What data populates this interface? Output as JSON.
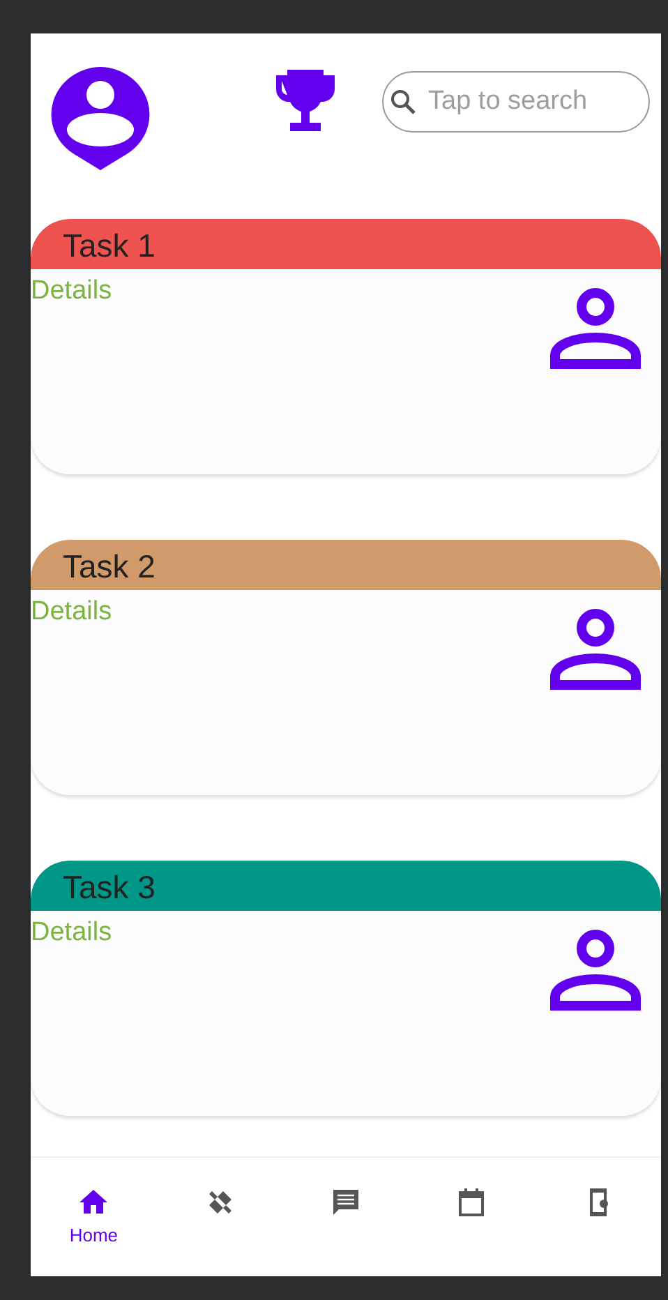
{
  "header": {
    "search": {
      "placeholder": "Tap to search"
    }
  },
  "tasks": [
    {
      "title": "Task 1",
      "details": "Details",
      "color": "#ef5350"
    },
    {
      "title": "Task 2",
      "details": "Details",
      "color": "#d09a6a"
    },
    {
      "title": "Task 3",
      "details": "Details",
      "color": "#009688"
    }
  ],
  "bottom_nav": [
    {
      "kind": "home",
      "label": "Home",
      "selected": true
    },
    {
      "kind": "tools",
      "selected": false
    },
    {
      "kind": "chat",
      "selected": false
    },
    {
      "kind": "calendar",
      "selected": false
    },
    {
      "kind": "device",
      "selected": false
    }
  ]
}
